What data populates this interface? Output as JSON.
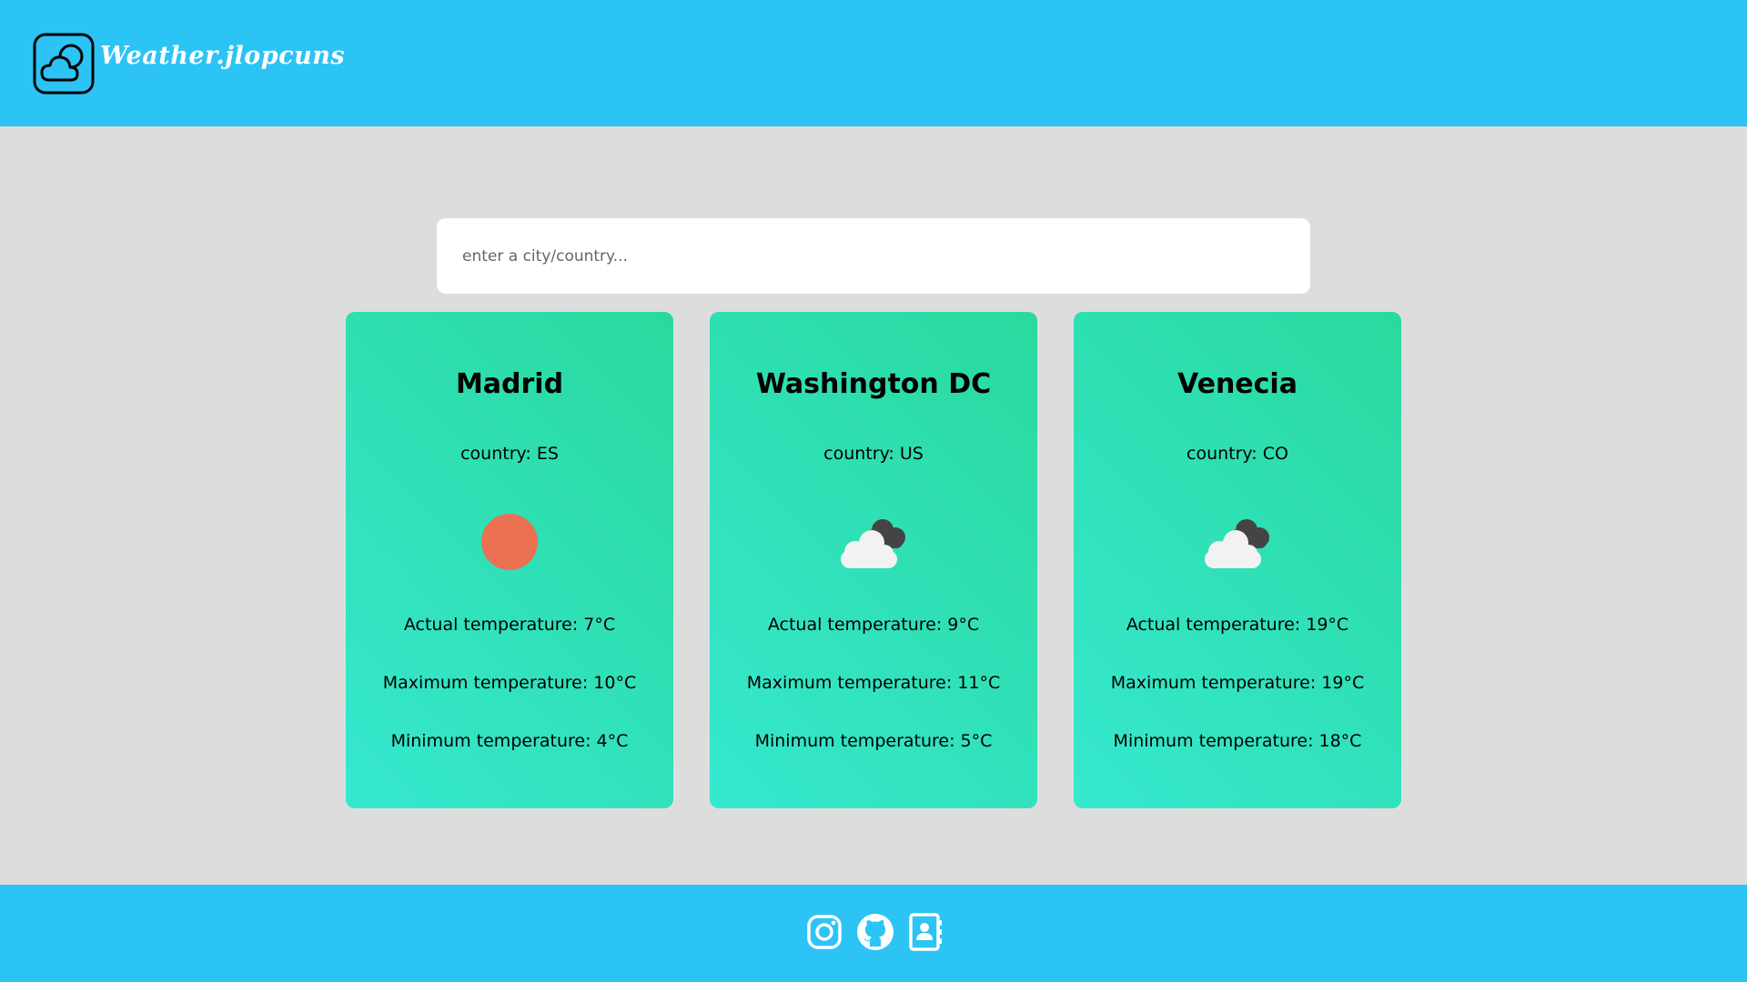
{
  "app": {
    "title": "Weather.jlopcuns",
    "logo_icon": "cloud-sun-icon"
  },
  "search": {
    "placeholder": "enter a city/country...",
    "value": ""
  },
  "cards": [
    {
      "city": "Madrid",
      "country": "country: ES",
      "icon": "sun-icon",
      "actual": "Actual temperature: 7°C",
      "max": "Maximum temperature: 10°C",
      "min": "Minimum temperature: 4°C"
    },
    {
      "city": "Washington DC",
      "country": "country: US",
      "icon": "cloudy-icon",
      "actual": "Actual temperature: 9°C",
      "max": "Maximum temperature: 11°C",
      "min": "Minimum temperature: 5°C"
    },
    {
      "city": "Venecia",
      "country": "country: CO",
      "icon": "cloudy-icon",
      "actual": "Actual temperature: 19°C",
      "max": "Maximum temperature: 19°C",
      "min": "Minimum temperature: 18°C"
    }
  ],
  "footer": {
    "icons": [
      "instagram-icon",
      "github-icon",
      "contact-book-icon"
    ]
  },
  "colors": {
    "header": "#2cc3f5",
    "background": "#dddddd",
    "card_gradient_start": "#36e8cf",
    "card_gradient_end": "#29d99e",
    "sun": "#ec7052"
  }
}
